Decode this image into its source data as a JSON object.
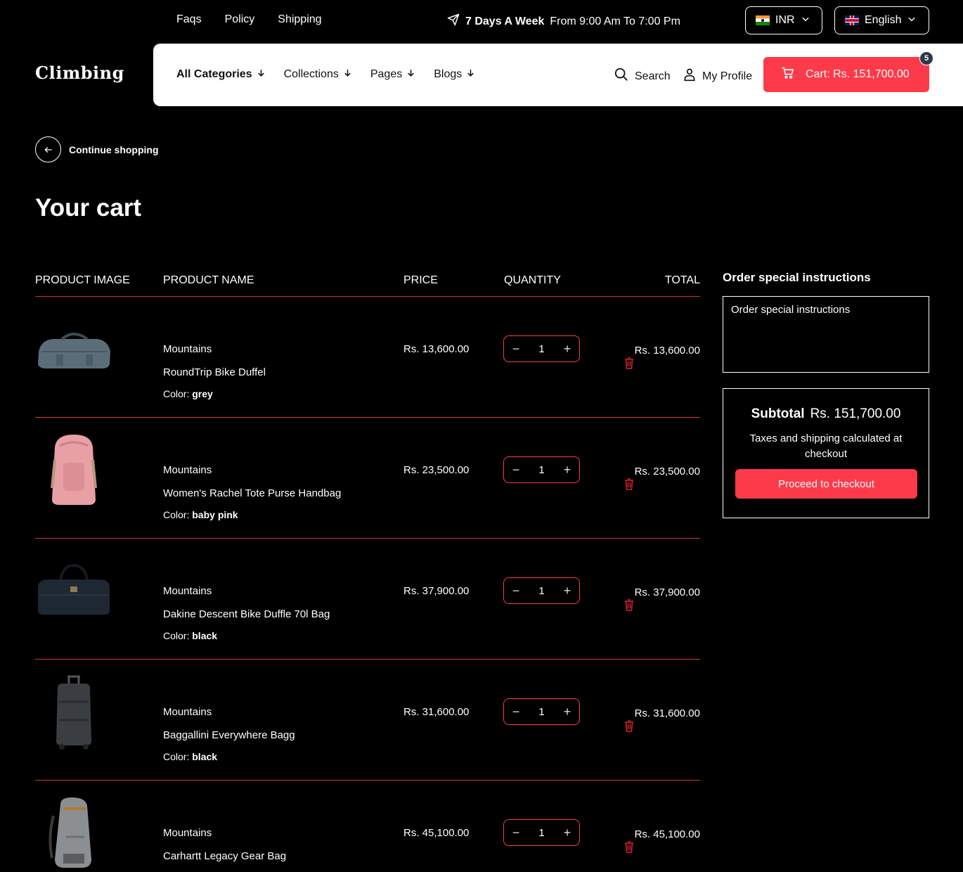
{
  "topbar": {
    "links": [
      "Faqs",
      "Policy",
      "Shipping"
    ],
    "hours_bold": "7 Days A Week",
    "hours_rest": "From 9:00 Am To 7:00 Pm",
    "currency": "INR",
    "language": "English"
  },
  "header": {
    "logo": "Climbing",
    "nav": [
      "All Categories",
      "Collections",
      "Pages",
      "Blogs"
    ],
    "search": "Search",
    "profile": "My Profile",
    "cart_label": "Cart: Rs. 151,700.00",
    "cart_count": "5"
  },
  "continue_label": "Continue shopping",
  "page_title": "Your cart",
  "table": {
    "headers": [
      "PRODUCT IMAGE",
      "PRODUCT NAME",
      "PRICE",
      "QUANTITY",
      "TOTAL"
    ],
    "color_prefix": "Color:",
    "rows": [
      {
        "vendor": "Mountains",
        "name": "RoundTrip Bike Duffel",
        "color": "grey",
        "price": "Rs. 13,600.00",
        "qty": "1",
        "total": "Rs. 13,600.00"
      },
      {
        "vendor": "Mountains",
        "name": "Women's Rachel Tote Purse Handbag",
        "color": "baby pink",
        "price": "Rs. 23,500.00",
        "qty": "1",
        "total": "Rs. 23,500.00"
      },
      {
        "vendor": "Mountains",
        "name": "Dakine Descent Bike Duffle 70l Bag",
        "color": "black",
        "price": "Rs. 37,900.00",
        "qty": "1",
        "total": "Rs. 37,900.00"
      },
      {
        "vendor": "Mountains",
        "name": "Baggallini Everywhere Bagg",
        "color": "black",
        "price": "Rs. 31,600.00",
        "qty": "1",
        "total": "Rs. 31,600.00"
      },
      {
        "vendor": "Mountains",
        "name": "Carhartt Legacy Gear Bag",
        "color": "",
        "price": "Rs. 45,100.00",
        "qty": "1",
        "total": "Rs. 45,100.00"
      }
    ]
  },
  "sidebar": {
    "instructions_title": "Order special instructions",
    "instructions_placeholder": "Order special instructions",
    "subtotal_label": "Subtotal",
    "subtotal_value": "Rs. 151,700.00",
    "taxes_note": "Taxes and shipping calculated at checkout",
    "checkout_label": "Proceed to checkout"
  },
  "colors": {
    "accent": "#fd3a4a",
    "background": "#000000"
  }
}
